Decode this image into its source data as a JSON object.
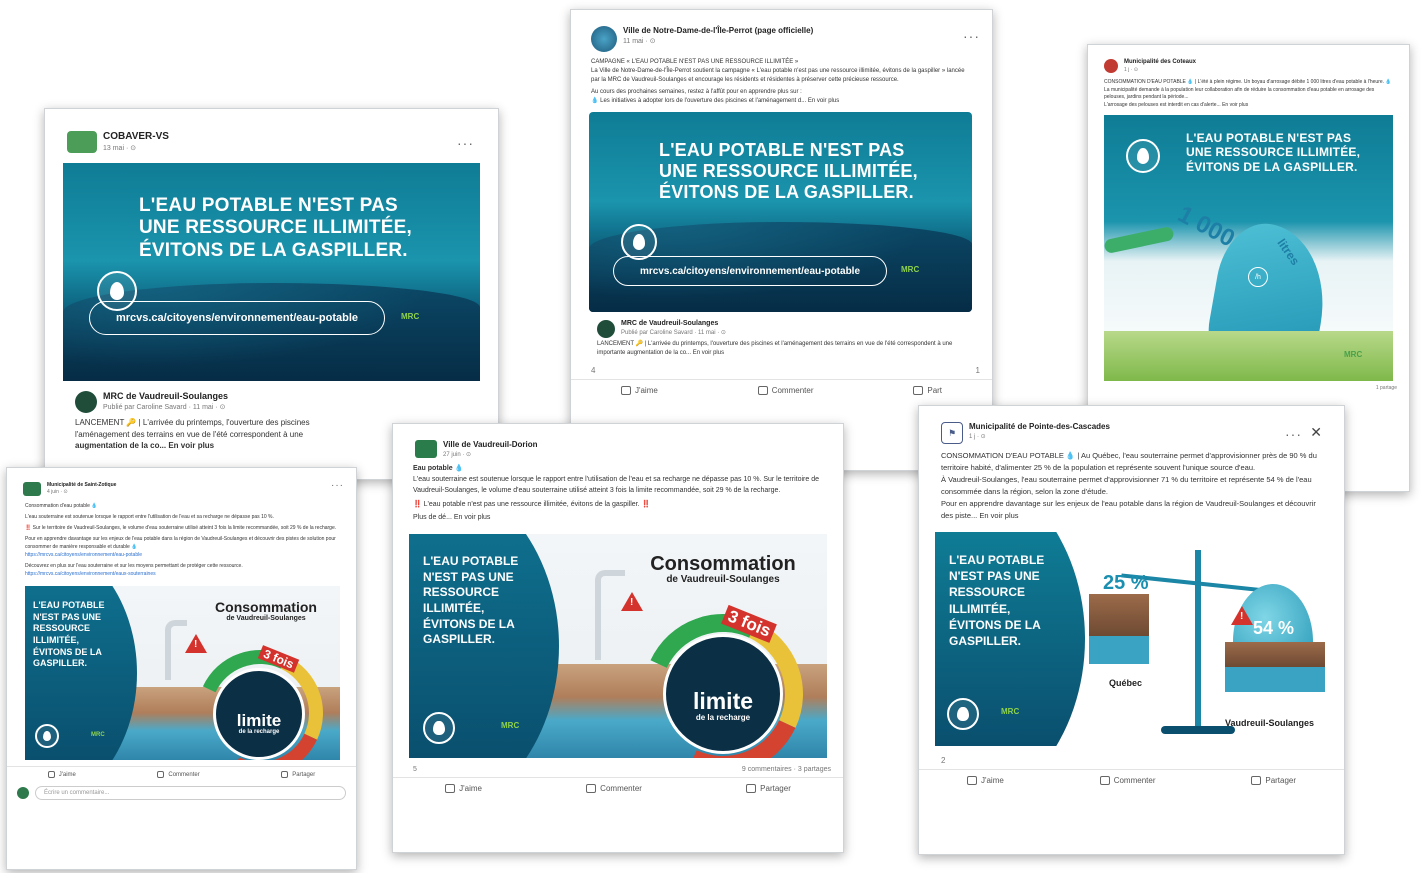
{
  "posts": {
    "cobaver": {
      "author": "COBAVER-VS",
      "meta": "13 mai · ⊙",
      "banner_title": "L'EAU POTABLE N'EST PAS UNE RESSOURCE ILLIMITÉE, ÉVITONS DE LA GASPILLER.",
      "url": "mrcvs.ca/citoyens/environnement/eau-potable",
      "mrc_logo": "MRC",
      "shared_author": "MRC de Vaudreuil-Soulanges",
      "shared_meta": "Publié par Caroline Savard · 11 mai · ⊙",
      "shared_text_1": "LANCEMENT 🔑 | L'arrivée du printemps, l'ouverture des piscines",
      "shared_text_2": "l'aménagement des terrains en vue de l'été correspondent à une",
      "shared_text_3": "augmentation de la co... En voir plus"
    },
    "notre_dame": {
      "author": "Ville de Notre-Dame-de-l'Île-Perrot (page officielle)",
      "meta": "11 mai · ⊙",
      "more": "···",
      "text_1": "CAMPAGNE « L'EAU POTABLE N'EST PAS UNE RESSOURCE ILLIMITÉE »",
      "text_2": "La Ville de Notre-Dame-de-l'Île-Perrot soutient la campagne « L'eau potable n'est pas une ressource illimitée, évitons de la gaspiller » lancée par la MRC de Vaudreuil-Soulanges et encourage les résidents et résidentes à préserver cette précieuse ressource.",
      "text_3": "Au cours des prochaines semaines, restez à l'affût pour en apprendre plus sur :",
      "text_4": "💧 Les initiatives à adopter lors de l'ouverture des piscines et l'aménagement d... En voir plus",
      "banner_title": "L'EAU POTABLE N'EST PAS UNE RESSOURCE ILLIMITÉE, ÉVITONS DE LA GASPILLER.",
      "url": "mrcvs.ca/citoyens/environnement/eau-potable",
      "mrc_logo": "MRC",
      "shared_author": "MRC de Vaudreuil-Soulanges",
      "shared_meta": "Publié par Caroline Savard · 11 mai · ⊙",
      "shared_text": "LANCEMENT 🔑 | L'arrivée du printemps, l'ouverture des piscines et l'aménagement des terrains en vue de l'été correspondent à une importante augmentation de la co... En voir plus",
      "reactions": "4",
      "comments_short": "1",
      "like": "J'aime",
      "comment": "Commenter",
      "share": "Part"
    },
    "coteaux": {
      "author": "Municipalité des Coteaux",
      "meta": "1 j · ⊙",
      "text_1": "CONSOMMATION D'EAU POTABLE 💧 | L'été à plein régime. Un boyau d'arrosage débite 1 000 litres d'eau potable à l'heure. 💧",
      "text_2": "La municipalité demande à la population leur collaboration afin de réduire la consommation d'eau potable en arrosage des pelouses, jardins pendant la période...",
      "text_3": "L'arrosage des pelouses est interdit en cas d'alerte... En voir plus",
      "banner_title": "L'EAU POTABLE N'EST PAS UNE RESSOURCE ILLIMITÉE, ÉVITONS DE LA GASPILLER.",
      "hose_num": "1 000",
      "hose_unit": "litres",
      "hose_per": "/h",
      "mrc_logo": "MRC",
      "shares": "1 partage"
    },
    "saint_zotique": {
      "author": "Municipalité de Saint-Zotique",
      "meta": "4 juin · ⊙",
      "text_1": "Consommation d'eau potable 💧",
      "text_2": "L'eau souterraine est soutenue lorsque le rapport entre l'utilisation de l'eau et sa recharge ne dépasse pas 10 %.",
      "text_3": "‼️ Sur le territoire de Vaudreuil-Soulanges, le volume d'eau souterraine utilisé atteint 3 fois la limite recommandée, soit 29 % de la recharge.",
      "text_4": "Pour en apprendre davantage sur les enjeux de l'eau potable dans la région de Vaudreuil-Soulanges et découvrir des pistes de solution pour consommer de manière responsable et durable 💧",
      "link_1": "https://mrcvs.ca/citoyens/environnement/eau-potable",
      "text_5": "Découvrez en plus sur l'eau souterraine et sur les moyens permettant de protéger cette ressource.",
      "link_2": "https://mrcvs.ca/citoyens/environnement/eaux-souterraines",
      "left_title": "L'EAU POTABLE N'EST PAS UNE RESSOURCE ILLIMITÉE, ÉVITONS DE LA GASPILLER.",
      "cons_title": "Consommation",
      "cons_sub": "de Vaudreuil-Soulanges",
      "fois": "3 fois",
      "limite": "limite",
      "recharge": "de la recharge",
      "mrc_logo": "MRC",
      "like": "J'aime",
      "comment": "Commenter",
      "share": "Partager",
      "comment_placeholder": "Écrire un commentaire..."
    },
    "vaudreuil_dorion": {
      "author": "Ville de Vaudreuil-Dorion",
      "meta": "27 juin · ⊙",
      "text_1": "Eau potable 💧",
      "text_2": "L'eau souterraine est soutenue lorsque le rapport entre l'utilisation de l'eau et sa recharge ne dépasse pas 10 %. Sur le territoire de Vaudreuil-Soulanges, le volume d'eau souterraine utilisé atteint 3 fois la limite recommandée, soit 29 % de la recharge.",
      "text_3": "‼️ L'eau potable n'est pas une ressource illimitée, évitons de la gaspiller. ‼️",
      "text_4": "Plus de dé... En voir plus",
      "left_title": "L'EAU POTABLE N'EST PAS UNE RESSOURCE ILLIMITÉE, ÉVITONS DE LA GASPILLER.",
      "cons_title": "Consommation",
      "cons_sub": "de Vaudreuil-Soulanges",
      "fois": "3 fois",
      "limite": "limite",
      "recharge": "de la recharge",
      "mrc_logo": "MRC",
      "reactions": "5",
      "stats": "9 commentaires · 3 partages",
      "like": "J'aime",
      "comment": "Commenter",
      "share": "Partager"
    },
    "pointe_cascades": {
      "author": "Municipalité de Pointe-des-Cascades",
      "meta": "1 j · ⊙",
      "more": "···",
      "close": "✕",
      "text_1": "CONSOMMATION D'EAU POTABLE 💧 | Au Québec, l'eau souterraine permet d'approvisionner près de 90 % du territoire habité, d'alimenter 25 % de la population et représente souvent l'unique source d'eau.",
      "text_2": "À Vaudreuil-Soulanges, l'eau souterraine permet d'approvisionner 71 % du territoire et représente 54 % de l'eau consommée dans la région, selon la zone d'étude.",
      "text_3": "Pour en apprendre davantage sur les enjeux de l'eau potable dans la région de Vaudreuil-Soulanges et découvrir des piste... En voir plus",
      "left_title": "L'EAU POTABLE N'EST PAS UNE RESSOURCE ILLIMITÉE, ÉVITONS DE LA GASPILLER.",
      "pct_left": "25 %",
      "pct_right": "54 %",
      "label_left": "Québec",
      "label_right": "Vaudreuil-Soulanges",
      "mrc_logo": "MRC",
      "reactions": "2",
      "like": "J'aime",
      "comment": "Commenter",
      "share": "Partager"
    }
  },
  "colors": {
    "brand_teal": "#0f7c95",
    "deep_navy": "#07334f",
    "alert_red": "#d3332c",
    "mrc_green": "#8fd34a"
  }
}
